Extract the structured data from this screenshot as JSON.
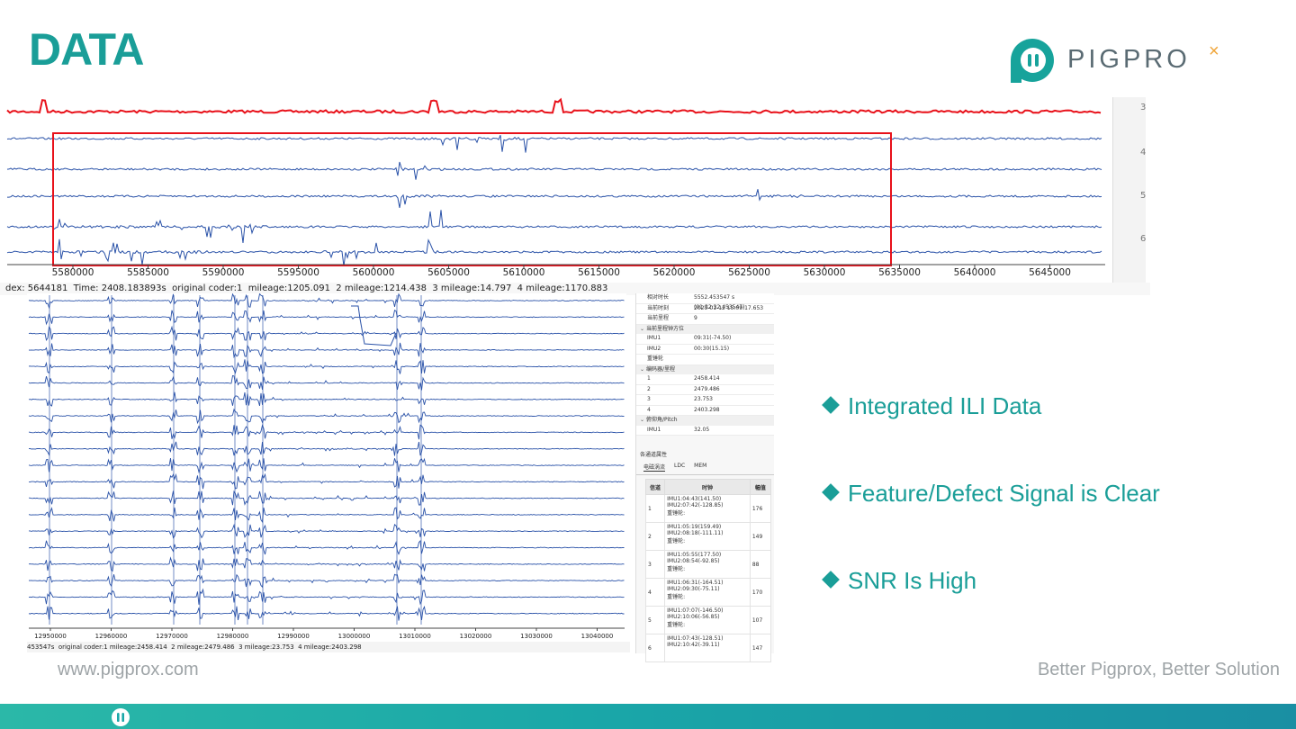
{
  "page": {
    "title": "DATA",
    "logo_text": "PIGPRO",
    "logo_suffix": "×",
    "website": "www.pigprox.com",
    "slogan": "Better Pigprox, Better Solution"
  },
  "colors": {
    "accent": "#1a9e98",
    "signal_blue": "#2a52a8",
    "signal_red": "#e8111a",
    "footer_gray": "#9ea4a7"
  },
  "upper_chart": {
    "x_ticks": [
      "5580000",
      "5585000",
      "5590000",
      "5595000",
      "5600000",
      "5605000",
      "5610000",
      "5615000",
      "5620000",
      "5625000",
      "5630000",
      "5635000",
      "5640000",
      "5645000"
    ],
    "side_ticks": [
      "3",
      "4",
      "5",
      "6"
    ],
    "status": "dex: 5644181  Time: 2408.183893s  original coder:1  mileage:1205.091  2 mileage:1214.438  3 mileage:14.797  4 mileage:1170.883"
  },
  "lower_chart": {
    "x_ticks": [
      "12950000",
      "12960000",
      "12970000",
      "12980000",
      "12990000",
      "13000000",
      "13010000",
      "13020000",
      "13030000",
      "13040000"
    ],
    "status": "453547s  original coder:1 mileage:2458.414  2 mileage:2479.486  3 mileage:23.753  4 mileage:2403.298"
  },
  "properties": {
    "rows_top": [
      {
        "k": "相对时长",
        "v": "5552.453547 s (01:32:32.453547)"
      },
      {
        "k": "当前时刻",
        "v": "2025-01-12 15:09:17.653"
      },
      {
        "k": "当前里程",
        "v": "9"
      }
    ],
    "group_clock": "当前里程钟方位",
    "rows_clock": [
      {
        "k": "IMU1",
        "v": "09:31(-74.50)"
      },
      {
        "k": "IMU2",
        "v": "00:30(15.15)"
      },
      {
        "k": "重锤轮",
        "v": ""
      }
    ],
    "group_mileage": "编码器/里程",
    "rows_mileage": [
      {
        "k": "1",
        "v": "2458.414"
      },
      {
        "k": "2",
        "v": "2479.486"
      },
      {
        "k": "3",
        "v": "23.753"
      },
      {
        "k": "4",
        "v": "2403.298"
      }
    ],
    "group_pitch": "俯仰角/Pitch",
    "rows_pitch": [
      {
        "k": "IMU1",
        "v": "32.05"
      }
    ],
    "section_title": "各通道属性",
    "tabs": [
      "电磁涡流",
      "LDC",
      "MEM"
    ],
    "table_headers": [
      "信道",
      "时钟",
      "幅值"
    ],
    "table_rows": [
      {
        "ch": "1",
        "clock": "IMU1:04:43(141.50)\nIMU2:07:42(-128.85)\n重锤轮:",
        "amp": "176"
      },
      {
        "ch": "2",
        "clock": "IMU1:05:19(159.49)\nIMU2:08:18(-111.11)\n重锤轮:",
        "amp": "149"
      },
      {
        "ch": "3",
        "clock": "IMU1:05:55(177.50)\nIMU2:08:54(-92.85)\n重锤轮:",
        "amp": "88"
      },
      {
        "ch": "4",
        "clock": "IMU1:06:31(-164.51)\nIMU2:09:30(-75.11)\n重锤轮:",
        "amp": "170"
      },
      {
        "ch": "5",
        "clock": "IMU1:07:07(-146.50)\nIMU2:10:06(-56.85)\n重锤轮:",
        "amp": "107"
      },
      {
        "ch": "6",
        "clock": "IMU1:07:43(-128.51)\nIMU2:10:42(-39.11)",
        "amp": "147"
      }
    ]
  },
  "bullets": [
    "Integrated ILI Data",
    "Feature/Defect Signal is Clear",
    "SNR Is High"
  ]
}
